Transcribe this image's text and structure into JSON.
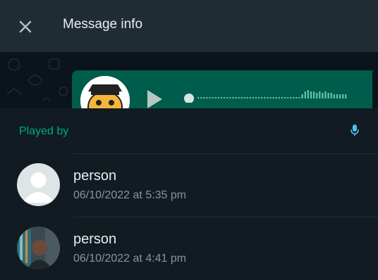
{
  "header": {
    "title": "Message info",
    "close_icon": "close-icon"
  },
  "message_preview": {
    "type": "voice-message",
    "sender_avatar_icon": "sticker-avatar-icon",
    "play_icon": "play-icon",
    "colors": {
      "bubble": "#005c4b",
      "waveform": "#5fc8a9"
    }
  },
  "section": {
    "label": "Played by",
    "icon": "microphone-icon"
  },
  "receipts": [
    {
      "name": "person",
      "time": "06/10/2022 at 5:35 pm",
      "avatar": "default-avatar-icon"
    },
    {
      "name": "person",
      "time": "06/10/2022 at 4:41 pm",
      "avatar": "photo-avatar"
    }
  ],
  "colors": {
    "background": "#111b21",
    "header": "#202c33",
    "accent": "#00a884",
    "primary_text": "#e9edef",
    "secondary_text": "#8696a0"
  }
}
